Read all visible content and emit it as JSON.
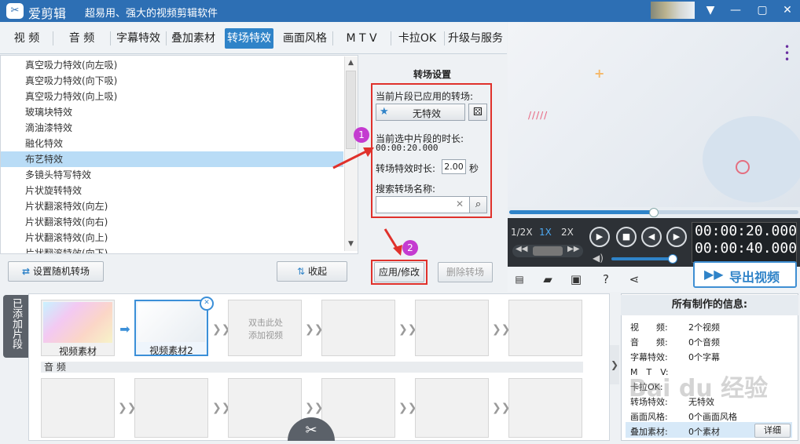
{
  "app": {
    "name": "爱剪辑",
    "slogan": "超易用、强大的视频剪辑软件"
  },
  "nav": {
    "tabs": [
      "视 频",
      "音 频",
      "字幕特效",
      "叠加素材",
      "转场特效",
      "画面风格",
      "M T V",
      "卡拉OK",
      "升级与服务"
    ],
    "active": "转场特效"
  },
  "effects": {
    "items": [
      "真空吸力特效(向左吸)",
      "真空吸力特效(向下吸)",
      "真空吸力特效(向上吸)",
      "玻璃块特效",
      "滴油漆特效",
      "融化特效",
      "布艺特效",
      "多镜头特写特效",
      "片状旋转特效",
      "片状翻滚特效(向左)",
      "片状翻滚特效(向右)",
      "片状翻滚特效(向上)",
      "片状翻滚特效(向下)"
    ],
    "selected": "布艺特效",
    "random_button": "设置随机转场",
    "collapse_button": "收起"
  },
  "settings": {
    "title": "转场设置",
    "applied_label": "当前片段已应用的转场:",
    "applied_value": "无特效",
    "duration_label": "当前选中片段的时长:",
    "duration_value": "00:00:20.000",
    "effect_duration_label": "转场特效时长:",
    "effect_duration_value": "2.00",
    "effect_duration_unit": "秒",
    "search_label": "搜索转场名称:",
    "search_value": "",
    "apply_button": "应用/修改",
    "delete_button": "删除转场",
    "annotation_1": "1",
    "annotation_2": "2"
  },
  "player": {
    "speeds": [
      "1/2X",
      "1X",
      "2X"
    ],
    "active_speed": "1X",
    "current_time": "00:00:20.000",
    "total_time": "00:00:40.000",
    "export_label": "导出视频"
  },
  "timeline": {
    "side_tab": "已添加片段",
    "clips": [
      {
        "label": "视频素材"
      },
      {
        "label": "视频素材2"
      }
    ],
    "add_video_hint": "双击此处\n添加视频",
    "audio_label": "音 频"
  },
  "info_panel": {
    "title": "所有制作的信息:",
    "rows": [
      {
        "key": "视　　频:",
        "value": "2个视频"
      },
      {
        "key": "音　　频:",
        "value": "0个音频"
      },
      {
        "key": "字幕特效:",
        "value": "0个字幕"
      },
      {
        "key": "M　T　V:",
        "value": ""
      },
      {
        "key": "卡拉OK:",
        "value": ""
      },
      {
        "key": "转场特效:",
        "value": "无特效"
      },
      {
        "key": "画面风格:",
        "value": "0个画面风格"
      },
      {
        "key": "叠加素材:",
        "value": "0个素材"
      }
    ],
    "detail_button": "详细"
  },
  "watermark": "Bai du 经验",
  "colors": {
    "titlebar": "#2d6fb4",
    "accent": "#2f83c8",
    "annotation_red": "#e0312b",
    "annotation_badge": "#c43bd0"
  }
}
